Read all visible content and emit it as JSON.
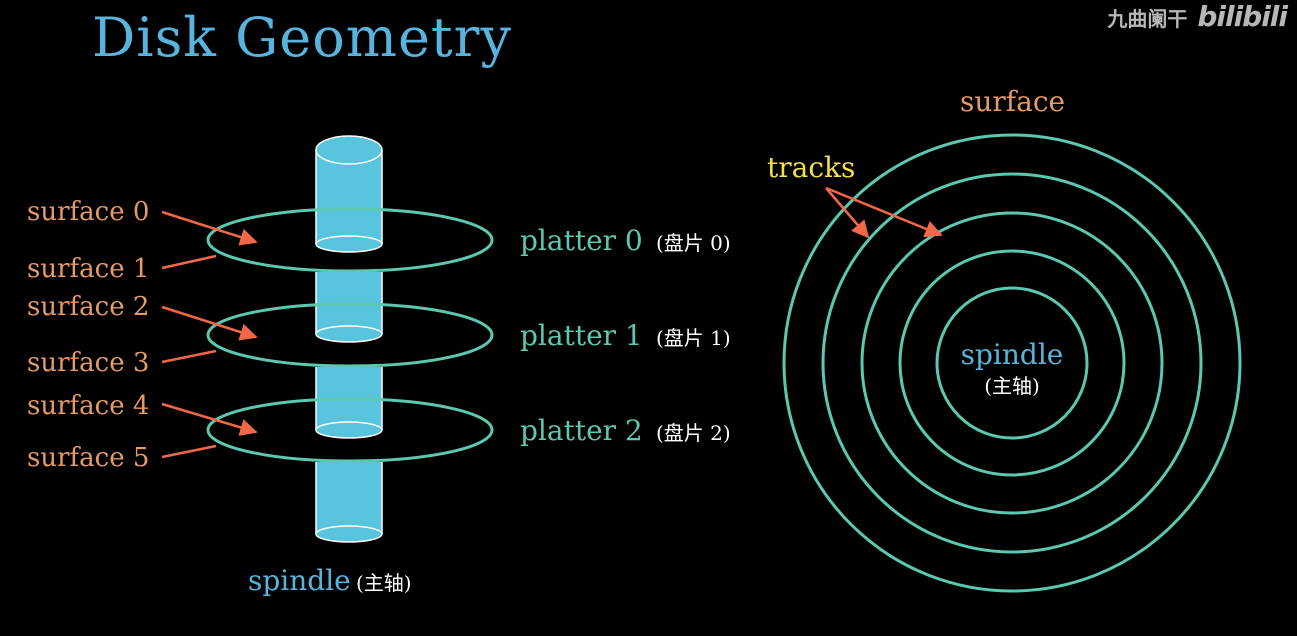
{
  "title": "Disk Geometry",
  "watermark": {
    "channel": "九曲阑干",
    "logo": "bilibili"
  },
  "colors": {
    "background": "#000000",
    "title": "#58b4dd",
    "spindle": "#58c4dd",
    "spindle_top": "#4fb3cc",
    "platter": "#5cc8b0",
    "surface_label": "#e69a66",
    "arrow": "#f06848",
    "tracks_label": "#f5e04a",
    "chinese_label": "#ffffff"
  },
  "left_diagram": {
    "surfaces": [
      "surface 0",
      "surface 1",
      "surface 2",
      "surface 3",
      "surface 4",
      "surface 5"
    ],
    "platters": [
      {
        "label": "platter 0",
        "cn": "(盘片 0)"
      },
      {
        "label": "platter 1",
        "cn": "(盘片 1)"
      },
      {
        "label": "platter 2",
        "cn": "(盘片 2)"
      }
    ],
    "spindle_label": "spindle",
    "spindle_cn": "(主轴)"
  },
  "right_diagram": {
    "surface_label": "surface",
    "tracks_label": "tracks",
    "spindle_label": "spindle",
    "spindle_cn": "(主轴)",
    "track_count": 5
  }
}
